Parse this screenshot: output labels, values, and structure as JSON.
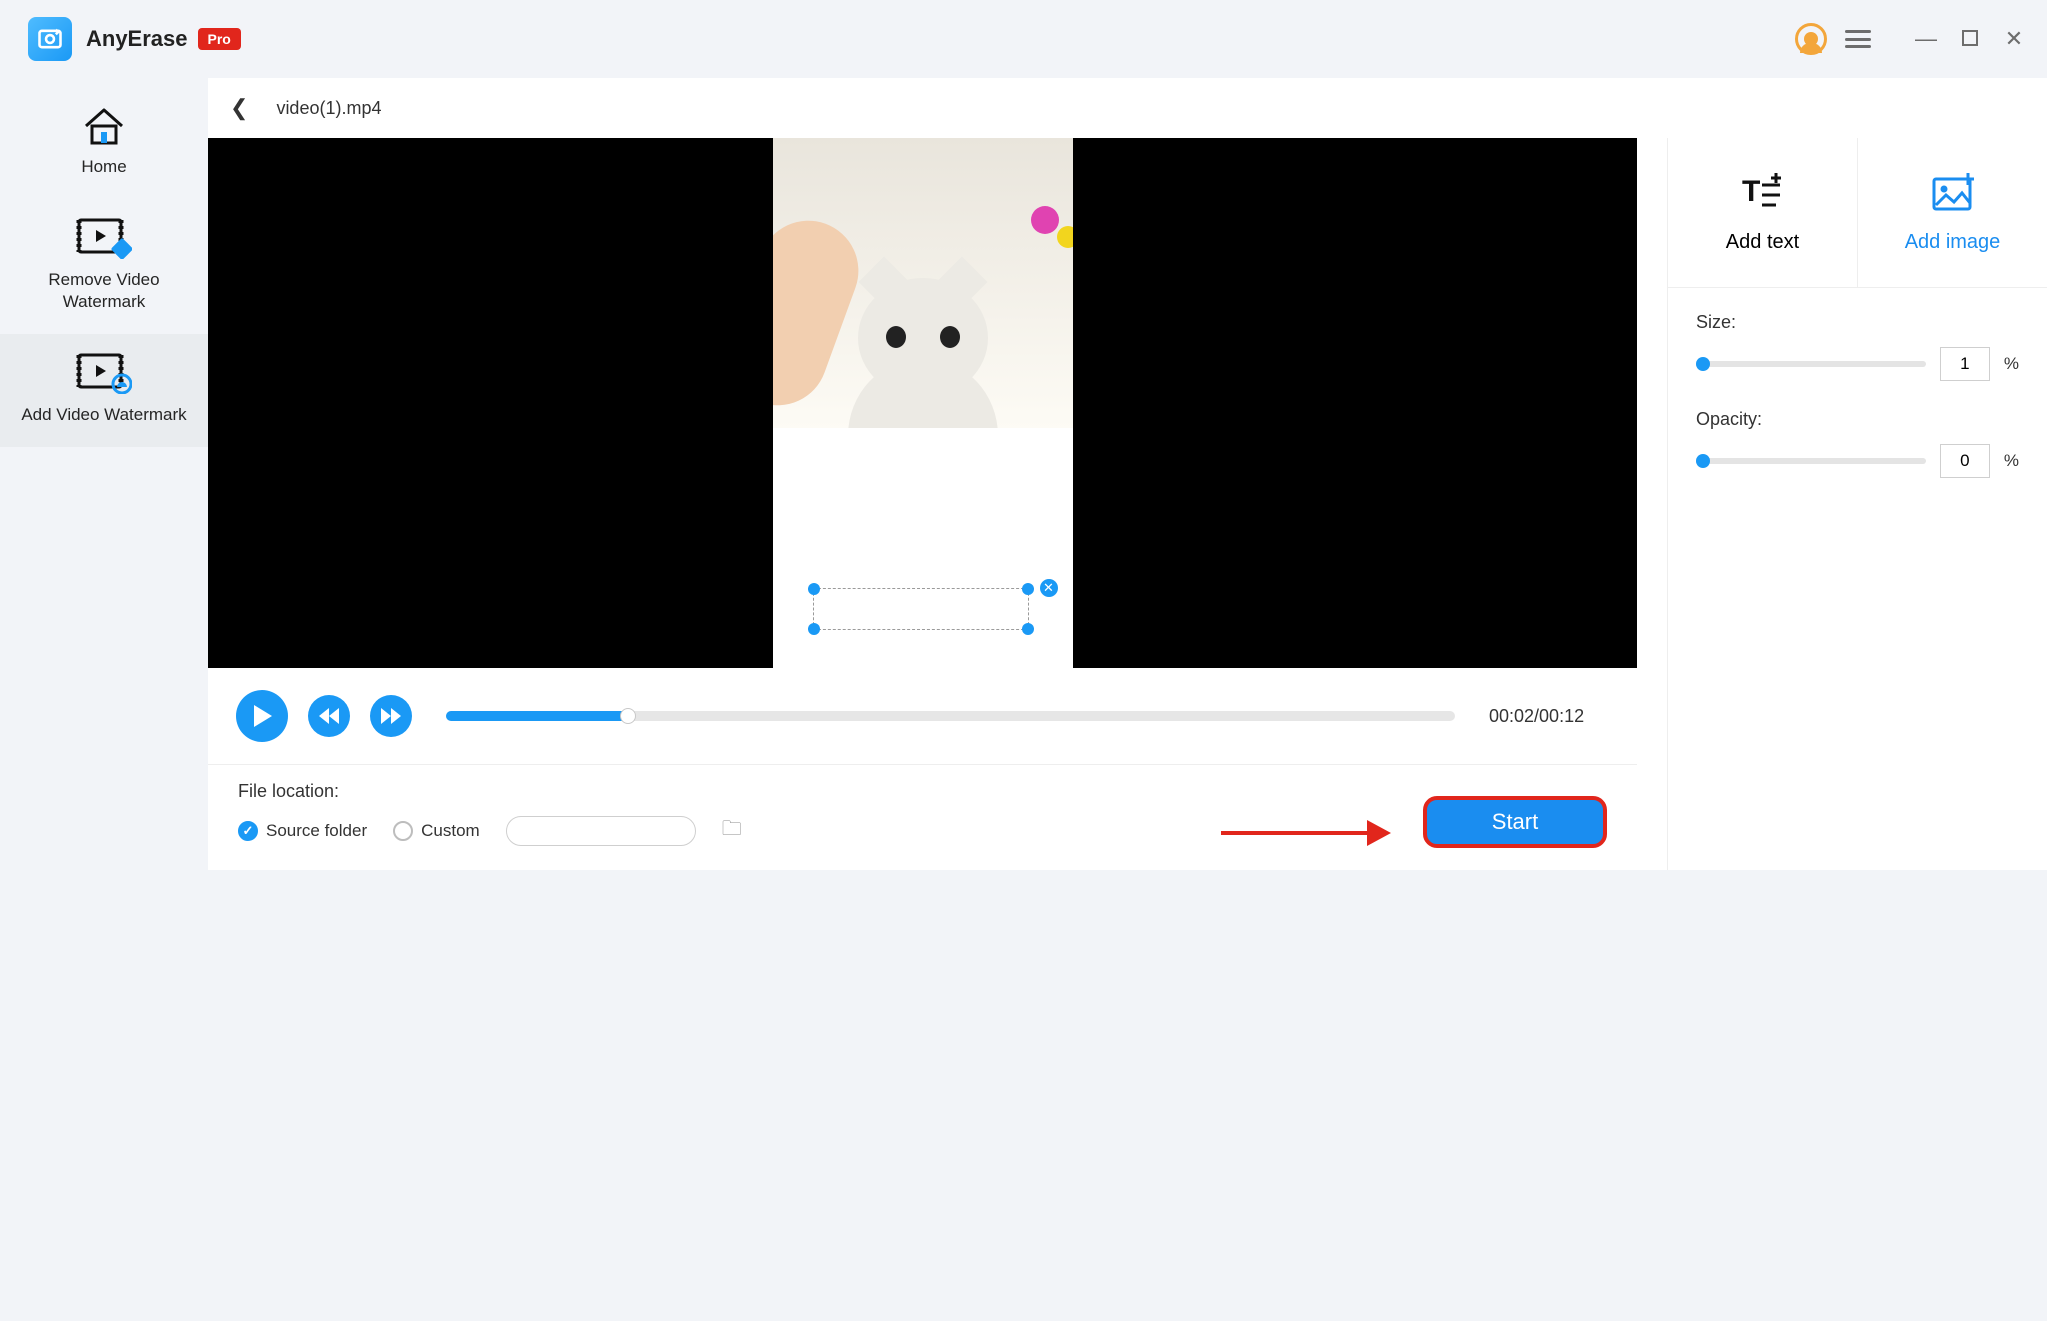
{
  "app": {
    "name": "AnyErase",
    "badge": "Pro"
  },
  "sidebar": {
    "items": [
      {
        "label": "Home"
      },
      {
        "label": "Remove Video Watermark"
      },
      {
        "label": "Add Video Watermark"
      }
    ],
    "selected_index": 2
  },
  "file": {
    "name": "video(1).mp4"
  },
  "playback": {
    "current": "00:02",
    "total": "00:12",
    "timecode": "00:02/00:12",
    "progress_percent": 18
  },
  "output": {
    "section_label": "File location:",
    "source_folder_label": "Source folder",
    "custom_label": "Custom",
    "selected": "source",
    "start_label": "Start"
  },
  "panel": {
    "tabs": {
      "text": "Add text",
      "image": "Add image",
      "active": "image"
    },
    "size": {
      "label": "Size:",
      "value": "1",
      "unit": "%"
    },
    "opacity": {
      "label": "Opacity:",
      "value": "0",
      "unit": "%"
    }
  }
}
